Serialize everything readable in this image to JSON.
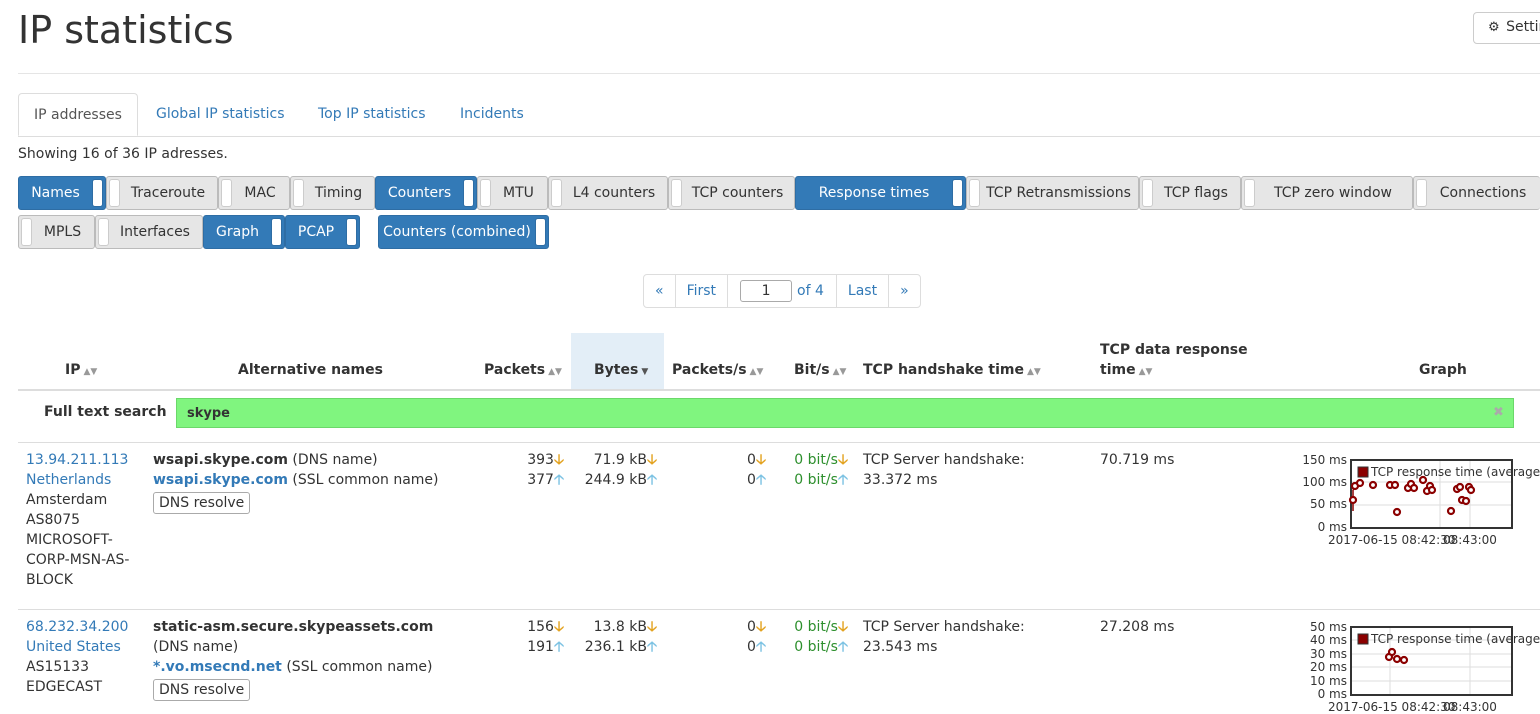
{
  "title": "IP statistics",
  "settings_label": "Settings",
  "tabs": [
    {
      "label": "IP addresses",
      "active": true
    },
    {
      "label": "Global IP statistics"
    },
    {
      "label": "Top IP statistics"
    },
    {
      "label": "Incidents"
    }
  ],
  "showing": "Showing 16 of 36 IP adresses.",
  "toggles": [
    {
      "label": "Names",
      "on": true
    },
    {
      "label": "Traceroute",
      "on": false
    },
    {
      "label": "MAC",
      "on": false
    },
    {
      "label": "Timing",
      "on": false
    },
    {
      "label": "Counters",
      "on": true
    },
    {
      "label": "MTU",
      "on": false
    },
    {
      "label": "L4 counters",
      "on": false
    },
    {
      "label": "TCP counters",
      "on": false
    },
    {
      "label": "Response times",
      "on": true
    },
    {
      "label": "TCP Retransmissions",
      "on": false
    },
    {
      "label": "TCP flags",
      "on": false
    },
    {
      "label": "TCP zero window",
      "on": false
    },
    {
      "label": "Connections",
      "on": false
    },
    {
      "label": "MPLS",
      "on": false
    },
    {
      "label": "Interfaces",
      "on": false
    },
    {
      "label": "Graph",
      "on": true
    },
    {
      "label": "PCAP",
      "on": true
    },
    {
      "label": "Counters (combined)",
      "on": true
    }
  ],
  "pager": {
    "prev": "«",
    "first": "First",
    "page": "1",
    "of": "of 4",
    "last": "Last",
    "next": "»"
  },
  "columns": {
    "ip": "IP",
    "alt": "Alternative names",
    "packets": "Packets",
    "bytes": "Bytes",
    "pps": "Packets/s",
    "bps": "Bit/s",
    "handshake": "TCP handshake time",
    "resp1": "TCP data response",
    "resp2": "time",
    "graph": "Graph"
  },
  "search": {
    "label": "Full text search",
    "value": "skype"
  },
  "rows": [
    {
      "ip": "13.94.211.113",
      "country": "Netherlands",
      "city": "Amsterdam",
      "asn": "AS8075",
      "org1": "MICROSOFT-",
      "org2": "CORP-MSN-AS-",
      "org3": "BLOCK",
      "alt1_name": "wsapi.skype.com",
      "alt1_type": "(DNS name)",
      "alt2_name": "wsapi.skype.com",
      "alt2_type": "(SSL common name)",
      "dns_btn": "DNS resolve",
      "pkt_in": "393",
      "pkt_out": "377",
      "bytes_in": "71.9 kB",
      "bytes_out": "244.9 kB",
      "pps_in": "0",
      "pps_out": "0",
      "bps_in": "0 bit/s",
      "bps_out": "0 bit/s",
      "hs_label": "TCP Server handshake:",
      "hs_value": "33.372 ms",
      "resp": "70.719 ms",
      "graph": {
        "legend": "TCP response time (average)",
        "y_ticks": [
          "150 ms",
          "100 ms",
          "50 ms",
          "0 ms"
        ],
        "x_ticks": [
          "2017-06-15 08:42:30",
          "08:43:00"
        ]
      }
    },
    {
      "ip": "68.232.34.200",
      "country": "United States",
      "asn": "AS15133",
      "org1": "EDGECAST",
      "alt1_name": "static-asm.secure.skypeassets.com",
      "alt1_type": "(DNS name)",
      "alt2_name": "*.vo.msecnd.net",
      "alt2_type": "(SSL common name)",
      "dns_btn": "DNS resolve",
      "pkt_in": "156",
      "pkt_out": "191",
      "bytes_in": "13.8 kB",
      "bytes_out": "236.1 kB",
      "pps_in": "0",
      "pps_out": "0",
      "bps_in": "0 bit/s",
      "bps_out": "0 bit/s",
      "hs_label": "TCP Server handshake:",
      "hs_value": "23.543 ms",
      "resp": "27.208 ms",
      "graph": {
        "legend": "TCP response time (average)",
        "y_ticks": [
          "50 ms",
          "40 ms",
          "30 ms",
          "20 ms",
          "10 ms",
          "0 ms"
        ],
        "x_ticks": [
          "2017-06-15 08:42:30",
          "08:43:00"
        ]
      }
    }
  ],
  "icons": {
    "down": "arrow-down-icon",
    "up": "arrow-up-icon",
    "gear": "gear-icon",
    "clear": "close-icon"
  },
  "colors": {
    "toggle_on": "#337ab7",
    "search_bg": "#80f57f",
    "series": "#8b0000",
    "down_arrow": "#e3a321",
    "up_arrow": "#7ec3e3"
  }
}
